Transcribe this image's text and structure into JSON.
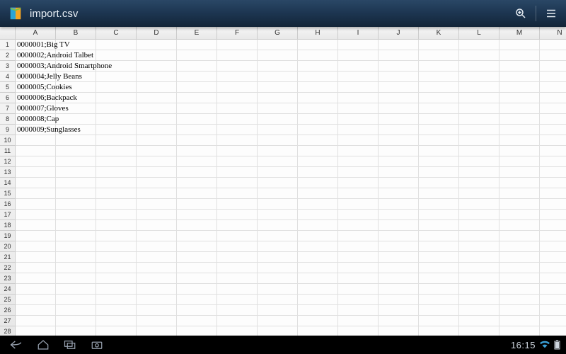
{
  "appbar": {
    "title": "import.csv"
  },
  "sheet": {
    "columns": [
      "A",
      "B",
      "C",
      "D",
      "E",
      "F",
      "G",
      "H",
      "I",
      "J",
      "K",
      "L",
      "M",
      "N"
    ],
    "row_count": 28,
    "rows": [
      {
        "A": "0000001;Big TV"
      },
      {
        "A": "0000002;Android Talbet"
      },
      {
        "A": "0000003;Android Smartphone"
      },
      {
        "A": "0000004;Jelly Beans"
      },
      {
        "A": "0000005;Cookies"
      },
      {
        "A": "0000006;Backpack"
      },
      {
        "A": "0000007;Gloves"
      },
      {
        "A": "0000008;Cap"
      },
      {
        "A": "0000009;Sunglasses"
      }
    ]
  },
  "navbar": {
    "clock": "16:15"
  }
}
